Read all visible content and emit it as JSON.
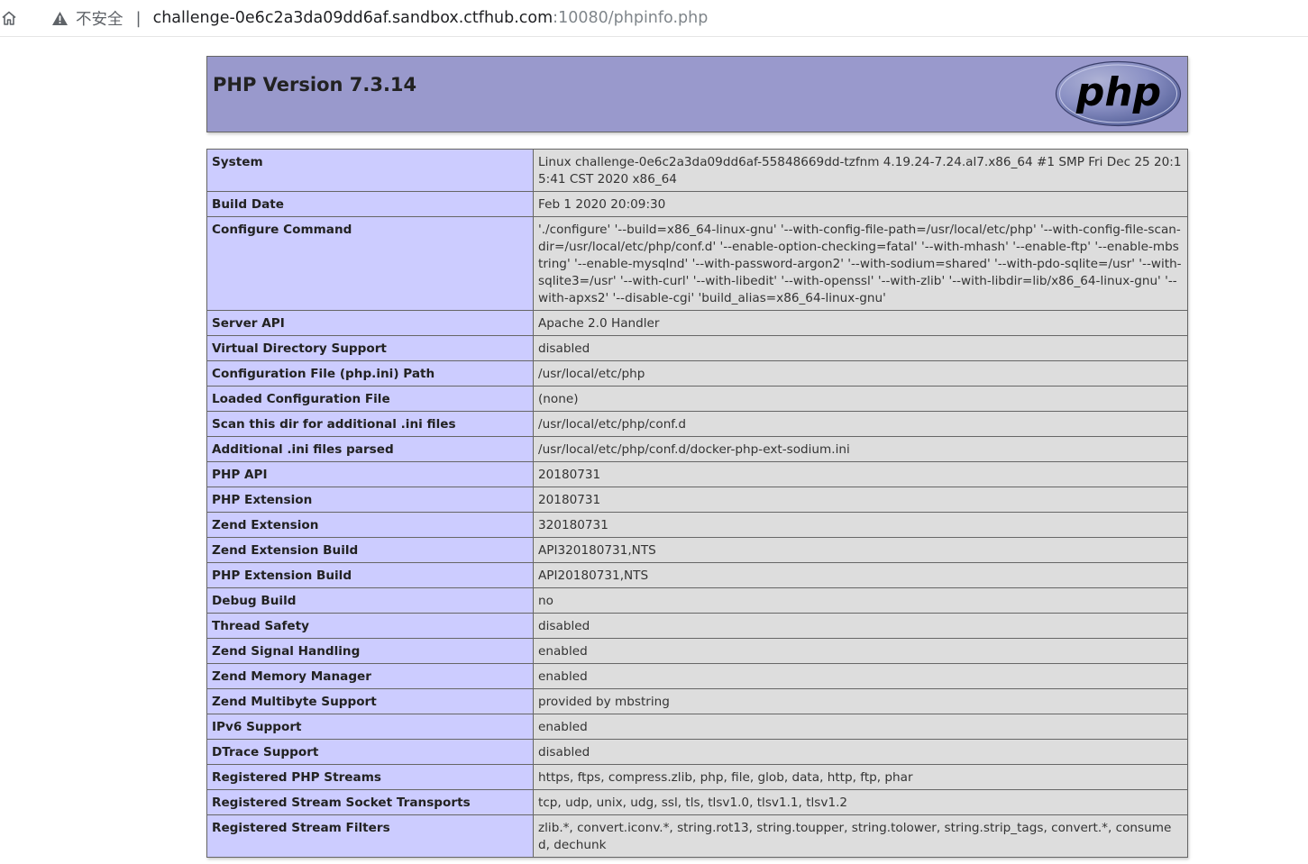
{
  "browser": {
    "security_label": "不安全",
    "separator": "|",
    "url_host": "challenge-0e6c2a3da09dd6af.sandbox.ctfhub.com",
    "url_rest": ":10080/phpinfo.php"
  },
  "header": {
    "title": "PHP Version 7.3.14",
    "logo_text": "php"
  },
  "rows": [
    {
      "key": "System",
      "value": "Linux challenge-0e6c2a3da09dd6af-55848669dd-tzfnm 4.19.24-7.24.al7.x86_64 #1 SMP Fri Dec 25 20:15:41 CST 2020 x86_64"
    },
    {
      "key": "Build Date",
      "value": "Feb 1 2020 20:09:30"
    },
    {
      "key": "Configure Command",
      "value": "'./configure' '--build=x86_64-linux-gnu' '--with-config-file-path=/usr/local/etc/php' '--with-config-file-scan-dir=/usr/local/etc/php/conf.d' '--enable-option-checking=fatal' '--with-mhash' '--enable-ftp' '--enable-mbstring' '--enable-mysqlnd' '--with-password-argon2' '--with-sodium=shared' '--with-pdo-sqlite=/usr' '--with-sqlite3=/usr' '--with-curl' '--with-libedit' '--with-openssl' '--with-zlib' '--with-libdir=lib/x86_64-linux-gnu' '--with-apxs2' '--disable-cgi' 'build_alias=x86_64-linux-gnu'"
    },
    {
      "key": "Server API",
      "value": "Apache 2.0 Handler"
    },
    {
      "key": "Virtual Directory Support",
      "value": "disabled"
    },
    {
      "key": "Configuration File (php.ini) Path",
      "value": "/usr/local/etc/php"
    },
    {
      "key": "Loaded Configuration File",
      "value": "(none)"
    },
    {
      "key": "Scan this dir for additional .ini files",
      "value": "/usr/local/etc/php/conf.d"
    },
    {
      "key": "Additional .ini files parsed",
      "value": "/usr/local/etc/php/conf.d/docker-php-ext-sodium.ini"
    },
    {
      "key": "PHP API",
      "value": "20180731"
    },
    {
      "key": "PHP Extension",
      "value": "20180731"
    },
    {
      "key": "Zend Extension",
      "value": "320180731"
    },
    {
      "key": "Zend Extension Build",
      "value": "API320180731,NTS"
    },
    {
      "key": "PHP Extension Build",
      "value": "API20180731,NTS"
    },
    {
      "key": "Debug Build",
      "value": "no"
    },
    {
      "key": "Thread Safety",
      "value": "disabled"
    },
    {
      "key": "Zend Signal Handling",
      "value": "enabled"
    },
    {
      "key": "Zend Memory Manager",
      "value": "enabled"
    },
    {
      "key": "Zend Multibyte Support",
      "value": "provided by mbstring"
    },
    {
      "key": "IPv6 Support",
      "value": "enabled"
    },
    {
      "key": "DTrace Support",
      "value": "disabled"
    },
    {
      "key": "Registered PHP Streams",
      "value": "https, ftps, compress.zlib, php, file, glob, data, http, ftp, phar"
    },
    {
      "key": "Registered Stream Socket Transports",
      "value": "tcp, udp, unix, udg, ssl, tls, tlsv1.0, tlsv1.1, tlsv1.2"
    },
    {
      "key": "Registered Stream Filters",
      "value": "zlib.*, convert.iconv.*, string.rot13, string.toupper, string.tolower, string.strip_tags, convert.*, consumed, dechunk"
    }
  ]
}
